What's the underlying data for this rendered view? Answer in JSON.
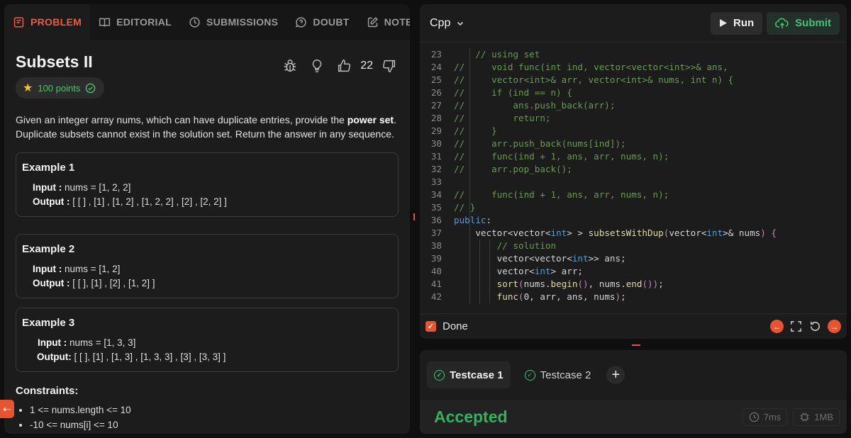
{
  "tabs": [
    {
      "label": "PROBLEM",
      "icon": "book-icon",
      "active": true
    },
    {
      "label": "EDITORIAL",
      "icon": "open-book-icon",
      "active": false
    },
    {
      "label": "SUBMISSIONS",
      "icon": "clock-icon",
      "active": false
    },
    {
      "label": "DOUBT",
      "icon": "chat-question-icon",
      "active": false
    },
    {
      "label": "NOTES",
      "icon": "note-edit-icon",
      "active": false
    }
  ],
  "problem": {
    "title": "Subsets II",
    "points": "100 points",
    "likes": "22",
    "description_pre": "Given an integer array nums, which can have duplicate entries, provide the ",
    "description_bold": "power set",
    "description_post": ". Duplicate subsets cannot exist in the solution set. Return the answer in any sequence.",
    "examples": [
      {
        "title": "Example 1",
        "input_label": "Input :",
        "input": " nums = [1, 2, 2]",
        "output_label": "Output :",
        "output": " [ [ ] , [1] , [1, 2] , [1, 2, 2] , [2] , [2, 2] ]"
      },
      {
        "title": "Example 2",
        "input_label": "Input :",
        "input": " nums = [1, 2]",
        "output_label": "Output :",
        "output": " [ [ ], [1] , [2] , [1, 2] ]"
      },
      {
        "title": "Example 3",
        "input_label": "Input :",
        "input": " nums = [1, 3, 3]",
        "output_label": "Output:",
        "output": " [ [ ], [1] , [1, 3] , [1, 3, 3] , [3] , [3, 3] ]"
      }
    ],
    "constraints_title": "Constraints:",
    "constraints": [
      "1 <= nums.length <= 10",
      "-10 <= nums[i] <= 10"
    ]
  },
  "editor": {
    "language": "Cpp",
    "run_label": "Run",
    "submit_label": "Submit",
    "done_label": "Done",
    "lines": [
      {
        "n": "23",
        "s": [
          [
            "tx",
            "    "
          ],
          [
            "cm",
            "// using set"
          ]
        ]
      },
      {
        "n": "24",
        "s": [
          [
            "cm",
            "//     void func(int ind, vector<vector<int>>& ans,"
          ]
        ]
      },
      {
        "n": "25",
        "s": [
          [
            "cm",
            "//     vector<int>& arr, vector<int>& nums, int n) {"
          ]
        ]
      },
      {
        "n": "26",
        "s": [
          [
            "cm",
            "//     if (ind == n) {"
          ]
        ]
      },
      {
        "n": "27",
        "s": [
          [
            "cm",
            "//         ans.push_back(arr);"
          ]
        ]
      },
      {
        "n": "28",
        "s": [
          [
            "cm",
            "//         return;"
          ]
        ]
      },
      {
        "n": "29",
        "s": [
          [
            "cm",
            "//     }"
          ]
        ]
      },
      {
        "n": "30",
        "s": [
          [
            "cm",
            "//     arr.push_back(nums[ind]);"
          ]
        ]
      },
      {
        "n": "31",
        "s": [
          [
            "cm",
            "//     func(ind + 1, ans, arr, nums, n);"
          ]
        ]
      },
      {
        "n": "32",
        "s": [
          [
            "cm",
            "//     arr.pop_back();"
          ]
        ]
      },
      {
        "n": "33",
        "s": [
          [
            "tx",
            ""
          ]
        ]
      },
      {
        "n": "34",
        "s": [
          [
            "cm",
            "//     func(ind + 1, ans, arr, nums, n);"
          ]
        ]
      },
      {
        "n": "35",
        "s": [
          [
            "cm",
            "// }"
          ]
        ]
      },
      {
        "n": "36",
        "s": [
          [
            "kw",
            "public"
          ],
          [
            "tx",
            ":"
          ]
        ]
      },
      {
        "n": "37",
        "s": [
          [
            "tx",
            "    vector<vector<"
          ],
          [
            "kw",
            "int"
          ],
          [
            "tx",
            "> > "
          ],
          [
            "fn",
            "subsetsWithDup"
          ],
          [
            "pu",
            "("
          ],
          [
            "tx",
            "vector<"
          ],
          [
            "kw",
            "int"
          ],
          [
            "tx",
            ">& nums"
          ],
          [
            "pu",
            ")"
          ],
          [
            "tx",
            " "
          ],
          [
            "pu",
            "{"
          ]
        ]
      },
      {
        "n": "38",
        "s": [
          [
            "tx",
            "        "
          ],
          [
            "cm",
            "// solution"
          ]
        ]
      },
      {
        "n": "39",
        "s": [
          [
            "tx",
            "        vector<vector<"
          ],
          [
            "kw",
            "int"
          ],
          [
            "tx",
            ">> ans;"
          ]
        ]
      },
      {
        "n": "40",
        "s": [
          [
            "tx",
            "        vector<"
          ],
          [
            "kw",
            "int"
          ],
          [
            "tx",
            "> arr;"
          ]
        ]
      },
      {
        "n": "41",
        "s": [
          [
            "tx",
            "        "
          ],
          [
            "fn",
            "sort"
          ],
          [
            "pu",
            "("
          ],
          [
            "tx",
            "nums."
          ],
          [
            "fn",
            "begin"
          ],
          [
            "pu",
            "()"
          ],
          [
            "tx",
            ", nums."
          ],
          [
            "fn",
            "end"
          ],
          [
            "pu",
            "())"
          ],
          [
            "tx",
            ";"
          ]
        ]
      },
      {
        "n": "42",
        "s": [
          [
            "tx",
            "        "
          ],
          [
            "fn",
            "func"
          ],
          [
            "pu",
            "("
          ],
          [
            "tx",
            "0, arr, ans, nums"
          ],
          [
            "pu",
            ")"
          ],
          [
            "tx",
            ";"
          ]
        ]
      }
    ]
  },
  "console": {
    "testcases": [
      {
        "label": "Testcase 1",
        "active": true
      },
      {
        "label": "Testcase 2",
        "active": false
      }
    ],
    "status": "Accepted",
    "time": "7ms",
    "memory": "1MB"
  },
  "colors": {
    "accent": "#e8542f",
    "accepted": "#2fb45a",
    "points": "#4ec46a"
  }
}
